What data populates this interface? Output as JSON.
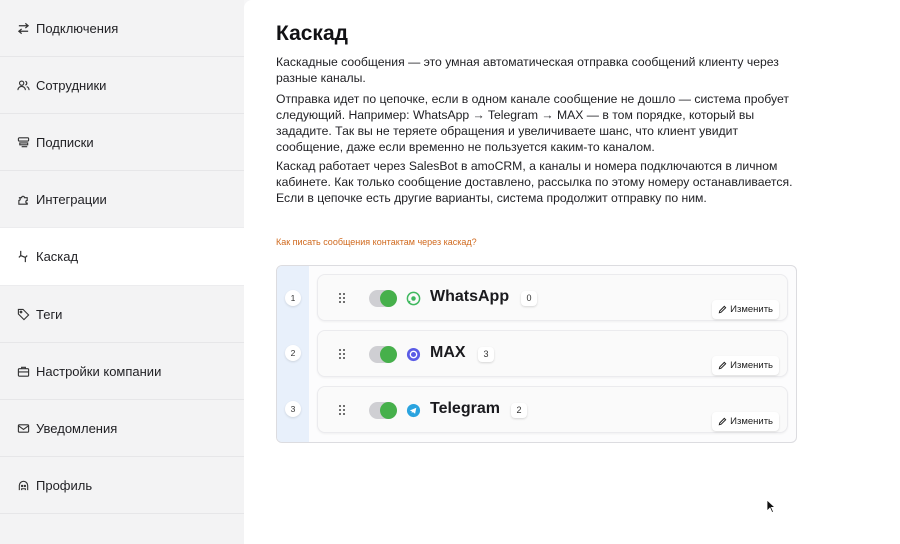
{
  "sidebar": {
    "items": [
      {
        "label": "Подключения",
        "icon": "arrows-swap-icon"
      },
      {
        "label": "Сотрудники",
        "icon": "users-icon"
      },
      {
        "label": "Подписки",
        "icon": "stack-icon"
      },
      {
        "label": "Интеграции",
        "icon": "puzzle-icon"
      },
      {
        "label": "Каскад",
        "icon": "cascade-icon",
        "active": true
      },
      {
        "label": "Теги",
        "icon": "tag-icon"
      },
      {
        "label": "Настройки компании",
        "icon": "briefcase-icon"
      },
      {
        "label": "Уведомления",
        "icon": "mail-icon"
      },
      {
        "label": "Профиль",
        "icon": "profile-icon"
      }
    ]
  },
  "main": {
    "title": "Каскад",
    "paragraphs": [
      "Каскадные сообщения — это умная автоматическая отправка сообщений клиенту через разные каналы.",
      "Отправка идет по цепочке, если в одном канале сообщение не дошло — система пробует следующий. Например: WhatsApp → Telegram → MAX — в том порядке, который вы зададите. Так вы не теряете обращения и увеличиваете шанс, что клиент увидит сообщение, даже если временно не пользуется каким-то каналом.",
      "Каскад работает через SalesBot в amoCRM, а каналы и номера подключаются в личном кабинете. Как только сообщение доставлено, рассылка по этому номеру останавливается. Если в цепочке есть другие варианты, система продолжит отправку по ним."
    ],
    "help_link": "Как писать сообщения контактам через каскад?"
  },
  "cascade": {
    "edit_label": "Изменить",
    "channels": [
      {
        "position": "1",
        "name": "WhatsApp",
        "count": "0",
        "enabled": true,
        "icon": "whatsapp-icon",
        "color": "#3fb85f"
      },
      {
        "position": "2",
        "name": "MAX",
        "count": "3",
        "enabled": true,
        "icon": "max-icon",
        "color": "#5b5ce6"
      },
      {
        "position": "3",
        "name": "Telegram",
        "count": "2",
        "enabled": true,
        "icon": "telegram-icon",
        "color": "#2aa3df"
      }
    ]
  },
  "colors": {
    "accent_toggle": "#46b04b",
    "link": "#d06a1f",
    "rail": "#e8f0fb"
  }
}
